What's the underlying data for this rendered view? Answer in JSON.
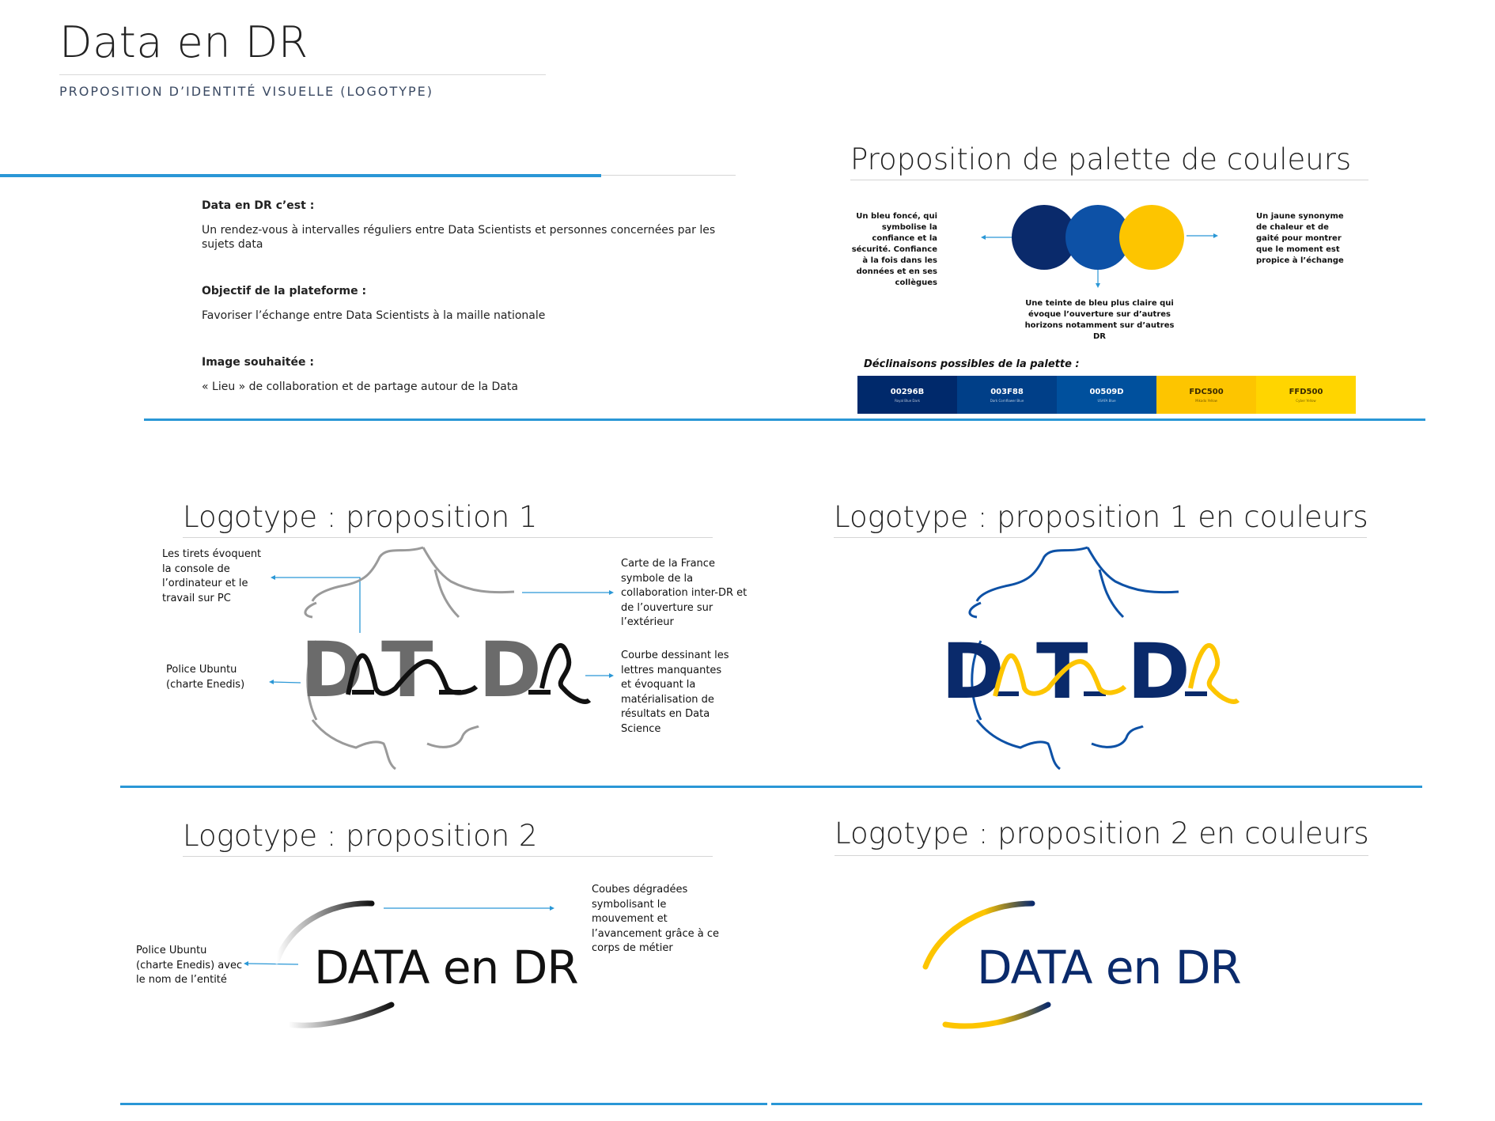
{
  "header": {
    "title": "Data en DR",
    "subtitle": "PROPOSITION D’IDENTITÉ VISUELLE (LOGOTYPE)"
  },
  "intro": {
    "blocks": [
      {
        "label": "Data en DR c’est :",
        "text": "Un rendez-vous à intervalles réguliers entre Data Scientists et personnes concernées par les sujets data"
      },
      {
        "label": "Objectif de la plateforme :",
        "text": "Favoriser l’échange entre Data Scientists à la maille nationale"
      },
      {
        "label": "Image souhaitée :",
        "text": "« Lieu » de collaboration et de partage autour de la Data"
      }
    ]
  },
  "palette": {
    "title": "Proposition de palette de couleurs",
    "left_note": "Un bleu foncé, qui symbolise la confiance et la sécurité. Confiance à la fois dans les données et en ses collègues",
    "bottom_note": "Une teinte de bleu plus claire qui évoque l’ouverture sur d’autres horizons notamment sur d’autres DR",
    "right_note": "Un jaune synonyme de chaleur et de gaité pour montrer que le moment est propice à l’échange",
    "circle_colors": [
      "#0a2a6b",
      "#0d51a6",
      "#fdc500"
    ],
    "variants_label": "Déclinaisons possibles de la palette :",
    "swatches": [
      {
        "code": "00296B",
        "name": "Royal Blue Dark",
        "color": "#00296b",
        "text_color": "#ffffff"
      },
      {
        "code": "003F88",
        "name": "Dark Cornflower Blue",
        "color": "#003f88",
        "text_color": "#ffffff"
      },
      {
        "code": "00509D",
        "name": "USAFA Blue",
        "color": "#00509d",
        "text_color": "#ffffff"
      },
      {
        "code": "FDC500",
        "name": "Mikado Yellow",
        "color": "#fdc500",
        "text_color": "#3a2a00"
      },
      {
        "code": "FFD500",
        "name": "Cyber Yellow",
        "color": "#ffd500",
        "text_color": "#3a2a00"
      }
    ]
  },
  "logo1": {
    "title": "Logotype : proposition 1",
    "note_dashes": "Les tirets évoquent la console de l’ordinateur et le travail sur PC",
    "note_font": "Police Ubuntu (charte Enedis)",
    "note_map": "Carte de la France symbole de la collaboration inter-DR et de l’ouverture sur l’extérieur",
    "note_curve": "Courbe dessinant les lettres manquantes et évoquant la matérialisation de résultats en Data Science",
    "letters": [
      "D",
      "T",
      "D"
    ]
  },
  "logo1_color": {
    "title": "Logotype : proposition 1 en couleurs",
    "letters": [
      "D",
      "T",
      "D"
    ]
  },
  "logo2": {
    "title": "Logotype : proposition 2",
    "note_font": "Police Ubuntu (charte Enedis) avec le nom de l’entité",
    "note_curves": "Coubes dégradées symbolisant le mouvement et l’avancement grâce à ce corps de métier",
    "wordmark": "DATA en DR"
  },
  "logo2_color": {
    "title": "Logotype : proposition 2 en couleurs",
    "wordmark": "DATA en DR"
  },
  "colors": {
    "accent_line": "#2a97d6",
    "dark_blue": "#0a2a6b",
    "mid_blue": "#0d51a6",
    "yellow": "#fdc500",
    "logo_grey": "#6b6b6b"
  }
}
